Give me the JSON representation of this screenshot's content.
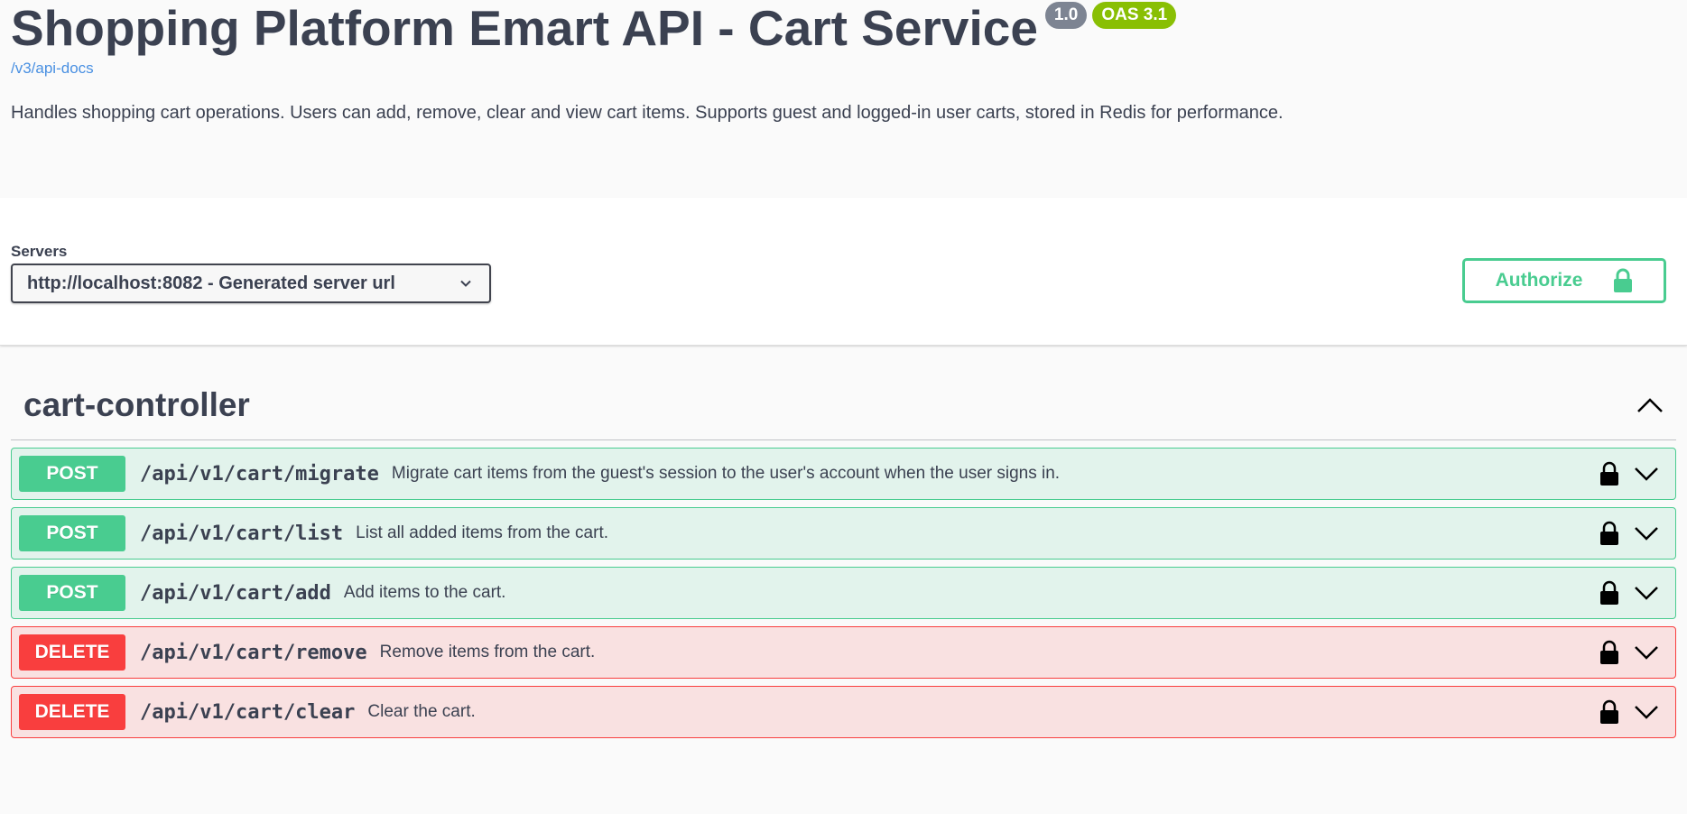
{
  "info": {
    "title": "Shopping Platform Emart API - Cart Service",
    "version_badge": "1.0",
    "oas_badge": "OAS 3.1",
    "api_docs_link": "/v3/api-docs",
    "description": "Handles shopping cart operations. Users can add, remove, clear and view cart items. Supports guest and logged-in user carts, stored in Redis for performance."
  },
  "servers": {
    "label": "Servers",
    "selected": "http://localhost:8082 - Generated server url"
  },
  "authorize": {
    "label": "Authorize",
    "icon": "lock-icon"
  },
  "tag": {
    "name": "cart-controller",
    "expanded": true
  },
  "operations": [
    {
      "method": "POST",
      "path": "/api/v1/cart/migrate",
      "summary": "Migrate cart items from the guest's session to the user's account when the user signs in."
    },
    {
      "method": "POST",
      "path": "/api/v1/cart/list",
      "summary": "List all added items from the cart."
    },
    {
      "method": "POST",
      "path": "/api/v1/cart/add",
      "summary": "Add items to the cart."
    },
    {
      "method": "DELETE",
      "path": "/api/v1/cart/remove",
      "summary": "Remove items from the cart."
    },
    {
      "method": "DELETE",
      "path": "/api/v1/cart/clear",
      "summary": "Clear the cart."
    }
  ],
  "colors": {
    "post": "#49cc90",
    "delete": "#f93e3e",
    "text": "#3b4151",
    "link": "#4990e2",
    "version_badge": "#7d8492",
    "oas_badge": "#89bf04"
  }
}
